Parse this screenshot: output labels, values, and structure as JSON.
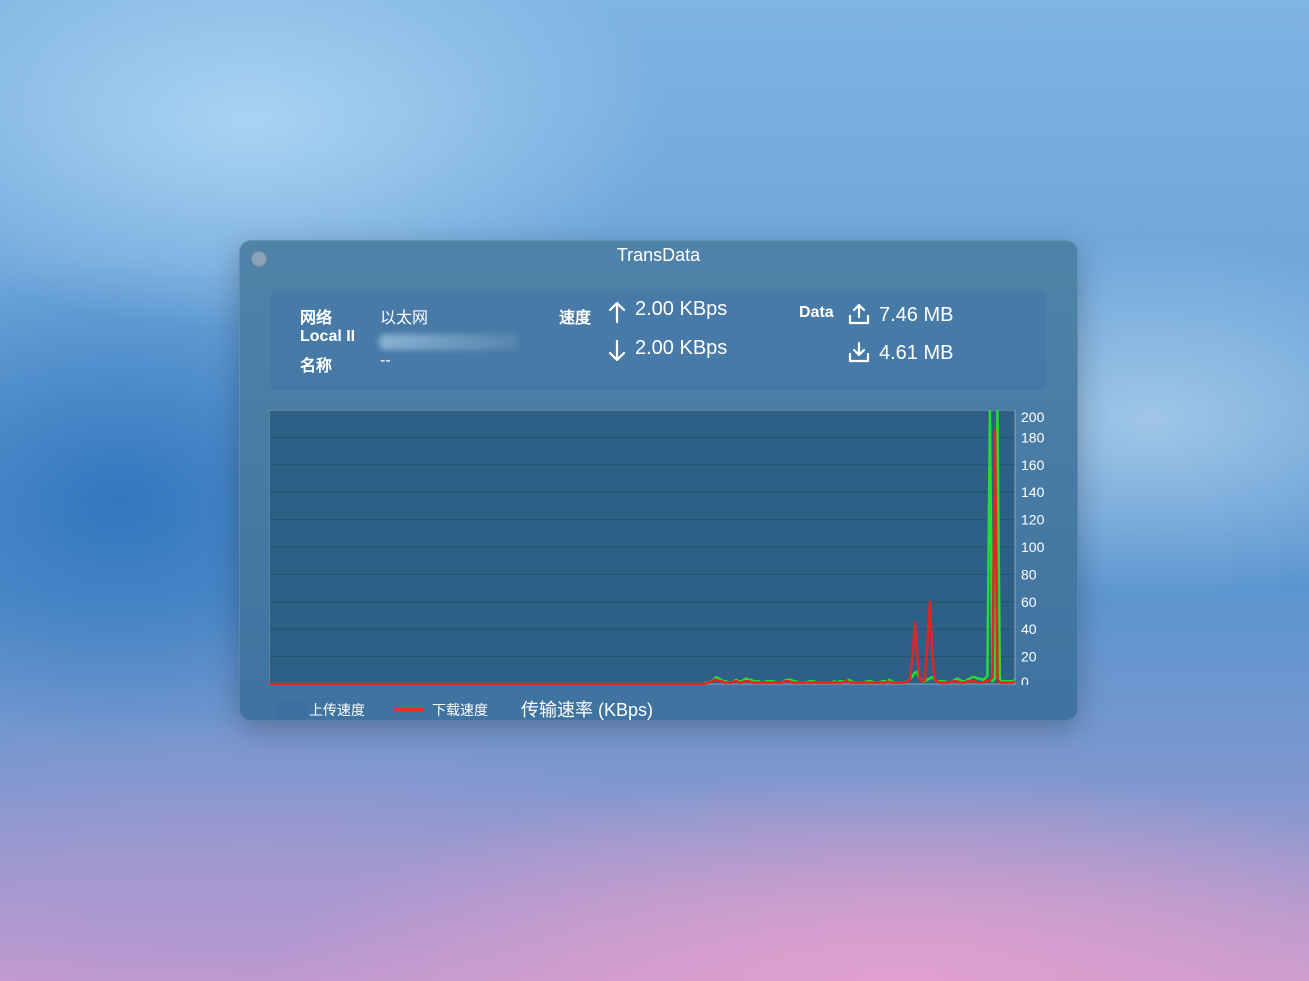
{
  "window": {
    "title": "TransData"
  },
  "info": {
    "network_label": "网络",
    "network_value": "以太网",
    "local_ip_label": "Local II",
    "name_label": "名称",
    "name_value": "--",
    "speed_label": "速度",
    "upload_speed": "2.00 KBps",
    "download_speed": "2.00 KBps",
    "data_label": "Data",
    "upload_total": "7.46 MB",
    "download_total": "4.61 MB"
  },
  "icons": {
    "upload_arrow": "arrow-up-icon",
    "download_arrow": "arrow-down-icon",
    "upload_tray": "upload-icon",
    "download_tray": "download-icon"
  },
  "legend": {
    "upload_label": "上传速度",
    "download_label": "下载速度",
    "caption": "传输速率 (KBps)"
  },
  "colors": {
    "upload_series": "#22dd33",
    "download_series": "#e02525",
    "plot_bg": "#2e5f86",
    "grid": "#23506f"
  },
  "chart_data": {
    "type": "line",
    "title": "",
    "xlabel": "",
    "ylabel": "传输速率 (KBps)",
    "ylim": [
      0,
      200
    ],
    "yticks": [
      "0",
      "20",
      "40",
      "60",
      "80",
      "100",
      "120",
      "140",
      "160",
      "180",
      "200"
    ],
    "grid": true,
    "legend_position": "bottom-left",
    "series": [
      {
        "name": "上传速度",
        "color": "#22dd33",
        "values": [
          0,
          0,
          0,
          0,
          0,
          0,
          0,
          0,
          0,
          0,
          0,
          0,
          0,
          0,
          0,
          0,
          0,
          0,
          0,
          0,
          0,
          0,
          0,
          0,
          0,
          0,
          0,
          0,
          0,
          0,
          0,
          0,
          0,
          0,
          0,
          0,
          0,
          0,
          0,
          0,
          0,
          0,
          0,
          0,
          0,
          0,
          0,
          0,
          0,
          0,
          0,
          0,
          0,
          0,
          0,
          0,
          0,
          0,
          0,
          0,
          0,
          0,
          0,
          0,
          0,
          0,
          0,
          0,
          0,
          0,
          0,
          0,
          0,
          0,
          0,
          0,
          0,
          0,
          0,
          0,
          0,
          0,
          0,
          0,
          0,
          0,
          0,
          0,
          0,
          0,
          0,
          0,
          0,
          0,
          0,
          0,
          0,
          0,
          0,
          0,
          0,
          0,
          0,
          0,
          0,
          0,
          0,
          0,
          0,
          0,
          0,
          0,
          0,
          0,
          0,
          0,
          0,
          0,
          0,
          0,
          0,
          0,
          0,
          0,
          0,
          0,
          0,
          0,
          0,
          0,
          0,
          0,
          0,
          0,
          0,
          0,
          0,
          0,
          0,
          0,
          0,
          0,
          0,
          0,
          0,
          0,
          0,
          0,
          0,
          0,
          0,
          0,
          0,
          0,
          0,
          0,
          0,
          0,
          0,
          0,
          0,
          0,
          0,
          0,
          0,
          0,
          0,
          0,
          0,
          0,
          0,
          0,
          0,
          0,
          1,
          1,
          2,
          3,
          5,
          4,
          3,
          2,
          2,
          1,
          1,
          2,
          3,
          2,
          2,
          3,
          4,
          3,
          3,
          2,
          2,
          2,
          1,
          1,
          2,
          2,
          2,
          2,
          1,
          1,
          1,
          2,
          3,
          3,
          3,
          2,
          2,
          1,
          1,
          1,
          1,
          2,
          2,
          2,
          1,
          1,
          1,
          1,
          1,
          1,
          1,
          2,
          1,
          2,
          2,
          2,
          2,
          3,
          2,
          1,
          1,
          1,
          1,
          1,
          2,
          2,
          2,
          1,
          1,
          1,
          2,
          2,
          2,
          3,
          2,
          1,
          1,
          1,
          1,
          1,
          2,
          3,
          5,
          8,
          9,
          4,
          2,
          2,
          3,
          4,
          5,
          3,
          2,
          2,
          2,
          2,
          1,
          1,
          2,
          3,
          4,
          3,
          2,
          2,
          3,
          4,
          5,
          5,
          4,
          4,
          3,
          4,
          6,
          200,
          2,
          4,
          200,
          3,
          2,
          2,
          2,
          2,
          2,
          3
        ]
      },
      {
        "name": "下载速度",
        "color": "#e02525",
        "values": [
          0,
          0,
          0,
          0,
          0,
          0,
          0,
          0,
          0,
          0,
          0,
          0,
          0,
          0,
          0,
          0,
          0,
          0,
          0,
          0,
          0,
          0,
          0,
          0,
          0,
          0,
          0,
          0,
          0,
          0,
          0,
          0,
          0,
          0,
          0,
          0,
          0,
          0,
          0,
          0,
          0,
          0,
          0,
          0,
          0,
          0,
          0,
          0,
          0,
          0,
          0,
          0,
          0,
          0,
          0,
          0,
          0,
          0,
          0,
          0,
          0,
          0,
          0,
          0,
          0,
          0,
          0,
          0,
          0,
          0,
          0,
          0,
          0,
          0,
          0,
          0,
          0,
          0,
          0,
          0,
          0,
          0,
          0,
          0,
          0,
          0,
          0,
          0,
          0,
          0,
          0,
          0,
          0,
          0,
          0,
          0,
          0,
          0,
          0,
          0,
          0,
          0,
          0,
          0,
          0,
          0,
          0,
          0,
          0,
          0,
          0,
          0,
          0,
          0,
          0,
          0,
          0,
          0,
          0,
          0,
          0,
          0,
          0,
          0,
          0,
          0,
          0,
          0,
          0,
          0,
          0,
          0,
          0,
          0,
          0,
          0,
          0,
          0,
          0,
          0,
          0,
          0,
          0,
          0,
          0,
          0,
          0,
          0,
          0,
          0,
          0,
          0,
          0,
          0,
          0,
          0,
          0,
          0,
          0,
          0,
          0,
          0,
          0,
          0,
          0,
          0,
          0,
          0,
          0,
          0,
          0,
          0,
          0,
          0,
          0,
          1,
          1,
          2,
          3,
          3,
          2,
          2,
          1,
          1,
          1,
          1,
          2,
          2,
          1,
          1,
          2,
          2,
          2,
          1,
          1,
          1,
          1,
          1,
          1,
          1,
          1,
          1,
          1,
          1,
          1,
          1,
          2,
          2,
          2,
          1,
          1,
          1,
          1,
          1,
          1,
          1,
          1,
          1,
          1,
          1,
          1,
          1,
          1,
          1,
          1,
          1,
          1,
          1,
          1,
          1,
          2,
          2,
          1,
          1,
          1,
          1,
          1,
          1,
          1,
          1,
          1,
          1,
          1,
          1,
          1,
          1,
          1,
          2,
          1,
          1,
          1,
          1,
          1,
          1,
          1,
          2,
          3,
          20,
          45,
          20,
          3,
          2,
          3,
          30,
          60,
          20,
          3,
          2,
          1,
          1,
          1,
          1,
          1,
          2,
          2,
          2,
          1,
          1,
          1,
          2,
          2,
          2,
          2,
          1,
          1,
          1,
          2,
          2,
          3,
          5,
          185,
          3,
          1,
          1,
          1,
          1,
          1,
          1,
          2
        ]
      }
    ]
  }
}
